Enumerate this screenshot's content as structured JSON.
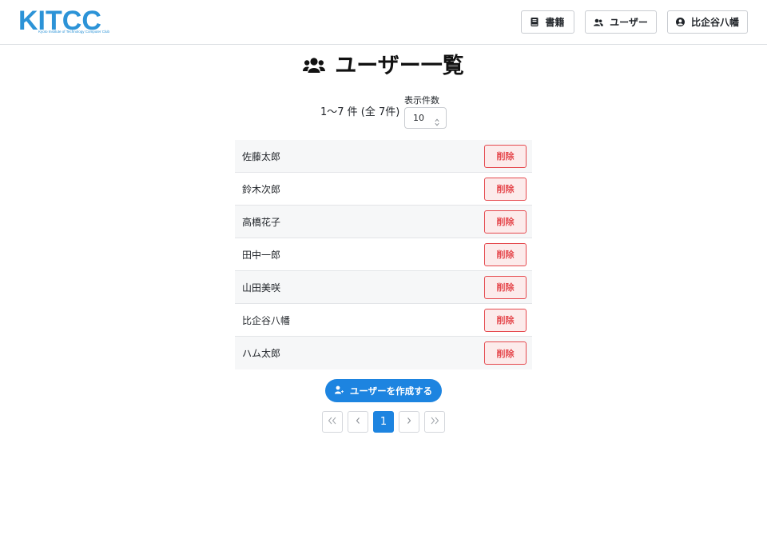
{
  "header": {
    "logo_text": "KITCC",
    "logo_subtitle": "Kyoto Institute of Technology Computer Club",
    "nav": {
      "books_label": "書籍",
      "users_label": "ユーザー",
      "profile_label": "比企谷八幡"
    }
  },
  "page": {
    "title": "ユーザー一覧",
    "count_text": "1～7 件 (全 7件)",
    "per_page_label": "表示件数",
    "per_page_value": "10"
  },
  "users": [
    {
      "name": "佐藤太郎",
      "delete_label": "削除"
    },
    {
      "name": "鈴木次郎",
      "delete_label": "削除"
    },
    {
      "name": "高橋花子",
      "delete_label": "削除"
    },
    {
      "name": "田中一郎",
      "delete_label": "削除"
    },
    {
      "name": "山田美咲",
      "delete_label": "削除"
    },
    {
      "name": "比企谷八幡",
      "delete_label": "削除"
    },
    {
      "name": "ハム太郎",
      "delete_label": "削除"
    }
  ],
  "create_button_label": "ユーザーを作成する",
  "pagination": {
    "current_page": "1"
  },
  "colors": {
    "brand": "#2c93d7",
    "primary": "#1d84e0",
    "danger": "#e5484d",
    "danger_bg": "#fcebeb"
  },
  "icons": [
    "book-icon",
    "users-icon",
    "user-circle-icon",
    "user-group-icon",
    "user-plus-icon",
    "chevron-double-left-icon",
    "chevron-left-icon",
    "chevron-right-icon",
    "chevron-double-right-icon",
    "sort-arrows-icon"
  ]
}
